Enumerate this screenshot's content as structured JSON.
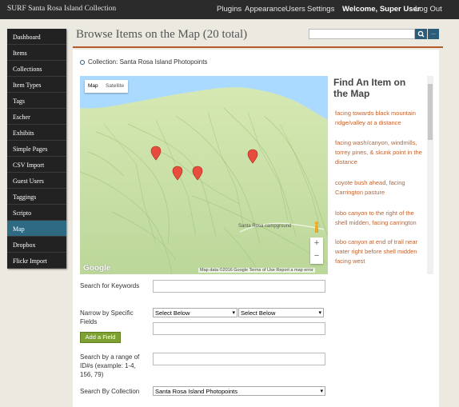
{
  "topbar": {
    "site_title": "SURF Santa Rosa Island Collection",
    "nav": [
      "Plugins",
      "Appearance",
      "Users",
      "Settings"
    ],
    "welcome": "Welcome, Super User",
    "logout": "Log Out"
  },
  "sidebar": {
    "items": [
      {
        "label": "Dashboard"
      },
      {
        "label": "Items"
      },
      {
        "label": "Collections"
      },
      {
        "label": "Item Types"
      },
      {
        "label": "Tags"
      },
      {
        "label": "Escher"
      },
      {
        "label": "Exhibits"
      },
      {
        "label": "Simple Pages"
      },
      {
        "label": "CSV Import"
      },
      {
        "label": "Guest Users"
      },
      {
        "label": "Taggings"
      },
      {
        "label": "Scripto"
      },
      {
        "label": "Map"
      },
      {
        "label": "Dropbox"
      },
      {
        "label": "Flickr Import"
      }
    ],
    "active_index": 12
  },
  "page": {
    "title": "Browse Items on the Map (20 total)",
    "breadcrumb": "Collection: Santa Rosa Island Photopoints",
    "search_advanced_label": "..."
  },
  "map": {
    "tab_map": "Map",
    "tab_satellite": "Satellite",
    "zoom_in": "+",
    "zoom_out": "−",
    "google_logo": "Google",
    "footer": "Map data ©2016 Google    Terms of Use    Report a map error",
    "place_label": "Santa Rosa campground",
    "colors": {
      "water": "#aadaff",
      "land": "#c9e0a6",
      "marker": "#e74c3c"
    }
  },
  "panel": {
    "title": "Find An Item on the Map",
    "entries": [
      "facing towards black mountain ridge/valley at a distance",
      "facing wash/canyon, windmills, torrey pines, & skunk point in the distance",
      "coyote bush ahead, facing Carrington pasture",
      "lobo canyon to the right of the shell midden, facing carrington",
      "lobo canyon at end of trail near water right before shell midden facing west"
    ]
  },
  "form": {
    "keywords_label": "Search for Keywords",
    "narrow_label": "Narrow by Specific Fields",
    "select_field": "Select Below",
    "select_type": "Select Below",
    "add_field_button": "Add a Field",
    "range_label": "Search by a range of ID#s (example: 1-4, 156, 79)",
    "collection_label": "Search By Collection",
    "collection_value": "Santa Rosa Island Photopoints"
  }
}
